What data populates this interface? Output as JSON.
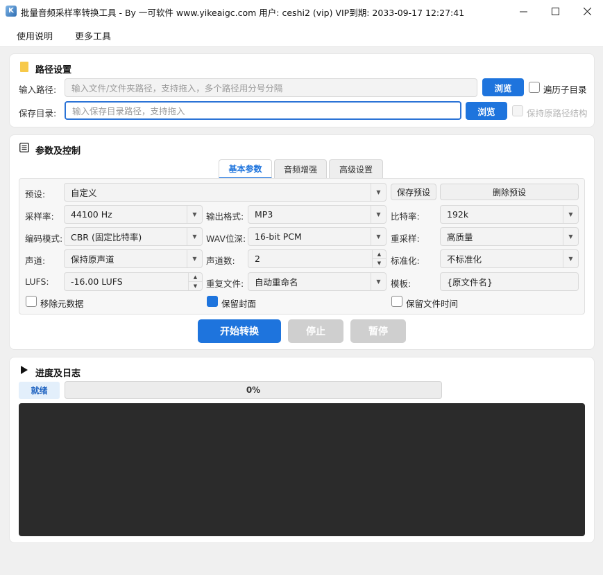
{
  "window": {
    "title": "批量音频采样率转换工具 - By 一可软件 www.yikeaigc.com 用户: ceshi2 (vip)  VIP到期: 2033-09-17 12:27:41"
  },
  "menu": {
    "items": [
      "使用说明",
      "更多工具"
    ]
  },
  "path_section": {
    "title": "路径设置",
    "input_label": "输入路径:",
    "input_placeholder": "输入文件/文件夹路径，支持拖入，多个路径用分号分隔",
    "input_browse": "浏览",
    "recurse_label": "遍历子目录",
    "recurse_checked": false,
    "save_label": "保存目录:",
    "save_placeholder": "输入保存目录路径，支持拖入",
    "save_browse": "浏览",
    "keep_structure_label": "保持原路径结构",
    "keep_structure_checked": false
  },
  "params_section": {
    "title": "参数及控制",
    "tabs": [
      "基本参数",
      "音频增强",
      "高级设置"
    ],
    "active_tab": 0,
    "preset": {
      "label": "预设:",
      "value": "自定义",
      "save": "保存预设",
      "delete": "删除预设"
    },
    "sample_rate": {
      "label": "采样率:",
      "value": "44100 Hz"
    },
    "output_format": {
      "label": "输出格式:",
      "value": "MP3"
    },
    "bitrate": {
      "label": "比特率:",
      "value": "192k"
    },
    "encode_mode": {
      "label": "编码模式:",
      "value": "CBR (固定比特率)"
    },
    "wav_depth": {
      "label": "WAV位深:",
      "value": "16-bit PCM"
    },
    "resample": {
      "label": "重采样:",
      "value": "高质量"
    },
    "channels_mode": {
      "label": "声道:",
      "value": "保持原声道"
    },
    "channel_count": {
      "label": "声道数:",
      "value": "2"
    },
    "normalize": {
      "label": "标准化:",
      "value": "不标准化"
    },
    "lufs": {
      "label": "LUFS:",
      "value": "-16.00 LUFS"
    },
    "duplicate": {
      "label": "重复文件:",
      "value": "自动重命名"
    },
    "template": {
      "label": "模板:",
      "value": "{原文件名}"
    },
    "remove_metadata": {
      "label": "移除元数据",
      "checked": false
    },
    "keep_cover": {
      "label": "保留封面",
      "checked": true
    },
    "keep_time": {
      "label": "保留文件时间",
      "checked": false
    },
    "start_button": "开始转换",
    "stop_button": "停止",
    "pause_button": "暂停"
  },
  "progress_section": {
    "title": "进度及日志",
    "status": "就绪",
    "progress_text": "0%",
    "progress_value": 0
  },
  "colors": {
    "accent": "#1e74dd",
    "disabled_button": "#cfcfcf",
    "log_background": "#2b2b2b"
  }
}
